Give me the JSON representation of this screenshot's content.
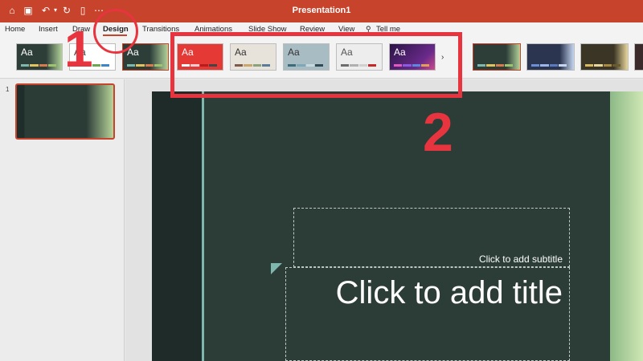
{
  "window": {
    "title": "Presentation1"
  },
  "tabs": [
    "Home",
    "Insert",
    "Draw",
    "Design",
    "Transitions",
    "Animations",
    "Slide Show",
    "Review",
    "View",
    "Tell me"
  ],
  "active_tab": "Design",
  "theme_label": "Aa",
  "gallery_more": "›",
  "slide_number": "1",
  "slide": {
    "subtitle_placeholder": "Click to add subtitle",
    "title_placeholder": "Click to add title"
  },
  "annotations": {
    "step1": "1",
    "step2": "2"
  },
  "colors": {
    "accent": "#c7432b",
    "annotation": "#e8343f"
  }
}
